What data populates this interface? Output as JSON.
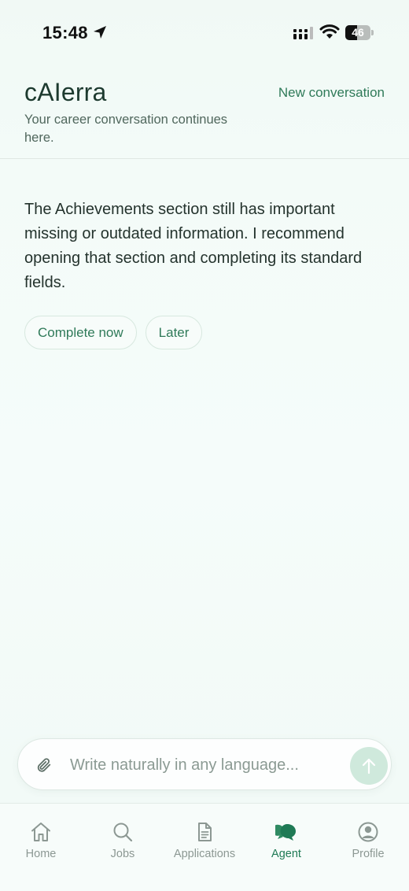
{
  "status_bar": {
    "time": "15:48",
    "battery_level": "46",
    "battery_fraction": 0.46,
    "icons": [
      "location-arrow-icon",
      "cellular-signal-icon",
      "wifi-icon",
      "battery-icon"
    ]
  },
  "header": {
    "title": "cAIerra",
    "subtitle": "Your career conversation continues here.",
    "new_conversation_label": "New conversation"
  },
  "conversation": {
    "message": "The Achievements section still has important missing or outdated information. I recommend opening that section and completing its standard fields.",
    "actions": {
      "complete_now_label": "Complete now",
      "later_label": "Later"
    }
  },
  "composer": {
    "placeholder": "Write naturally in any language...",
    "value": "",
    "attach_icon": "paperclip-icon",
    "send_icon": "arrow-up-icon"
  },
  "tab_bar": {
    "active": "Agent",
    "tabs": {
      "home": {
        "label": "Home",
        "icon": "home-icon"
      },
      "jobs": {
        "label": "Jobs",
        "icon": "search-icon"
      },
      "applications": {
        "label": "Applications",
        "icon": "document-icon"
      },
      "agent": {
        "label": "Agent",
        "icon": "chat-bubbles-icon"
      },
      "profile": {
        "label": "Profile",
        "icon": "user-circle-icon"
      }
    }
  },
  "colors": {
    "accent": "#2f7a59",
    "active_tab": "#1f7a55",
    "inactive_tab": "#8c9893",
    "background": "#f2faf6",
    "send_button": "#cfe9dc"
  }
}
